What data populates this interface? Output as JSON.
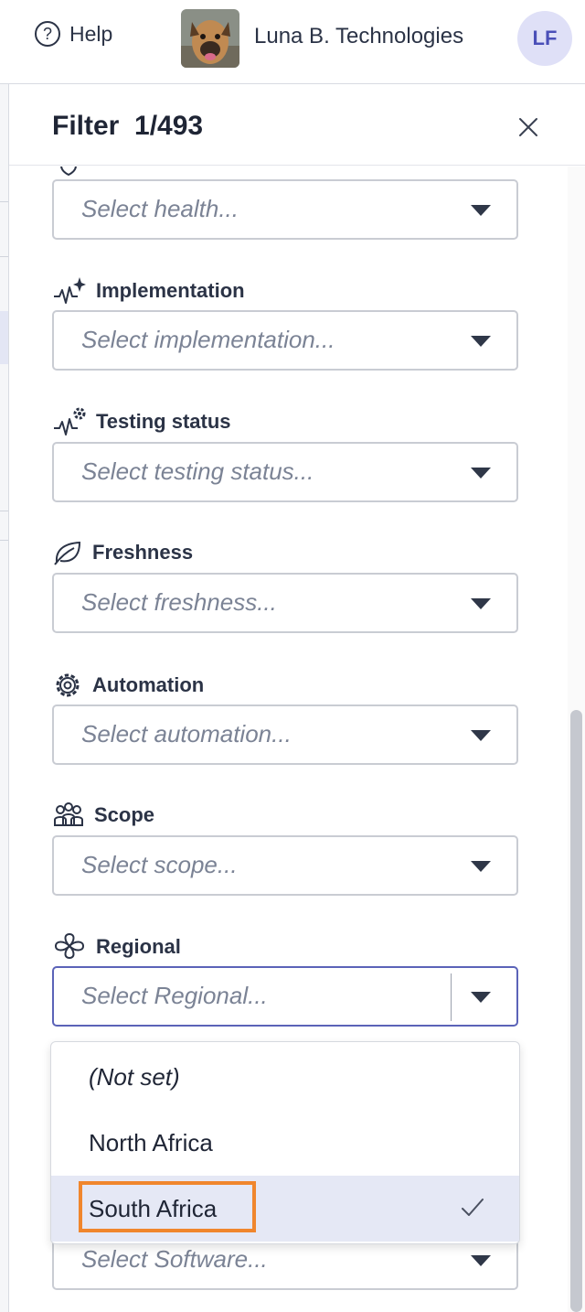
{
  "topbar": {
    "help_label": "Help",
    "help_icon": "question-circle-icon",
    "org_name": "Luna B. Technologies",
    "user_initials": "LF"
  },
  "panel": {
    "title": "Filter  1/493",
    "close_icon": "close-icon"
  },
  "fields": {
    "health": {
      "placeholder": "Select health...",
      "icon": "shield-icon"
    },
    "implementation": {
      "label": "Implementation",
      "placeholder": "Select implementation...",
      "icon": "pulse-sparkle-icon"
    },
    "testing": {
      "label": "Testing status",
      "placeholder": "Select testing status...",
      "icon": "pulse-gear-icon"
    },
    "freshness": {
      "label": "Freshness",
      "placeholder": "Select freshness...",
      "icon": "leaf-icon"
    },
    "automation": {
      "label": "Automation",
      "placeholder": "Select automation...",
      "icon": "gear-icon"
    },
    "scope": {
      "label": "Scope",
      "placeholder": "Select scope...",
      "icon": "people-icon"
    },
    "regional": {
      "label": "Regional",
      "placeholder": "Select Regional...",
      "icon": "clover-icon"
    },
    "software": {
      "placeholder": "Select Software..."
    }
  },
  "regional_menu": {
    "options": [
      "(Not set)",
      "North Africa",
      "South Africa"
    ],
    "selected": "South Africa",
    "check_icon": "check-icon"
  },
  "colors": {
    "accent": "#5b63b8",
    "selected_bg": "#e5e8f5",
    "highlight": "#f0862d",
    "avatar_bg": "#dfe0f7"
  }
}
